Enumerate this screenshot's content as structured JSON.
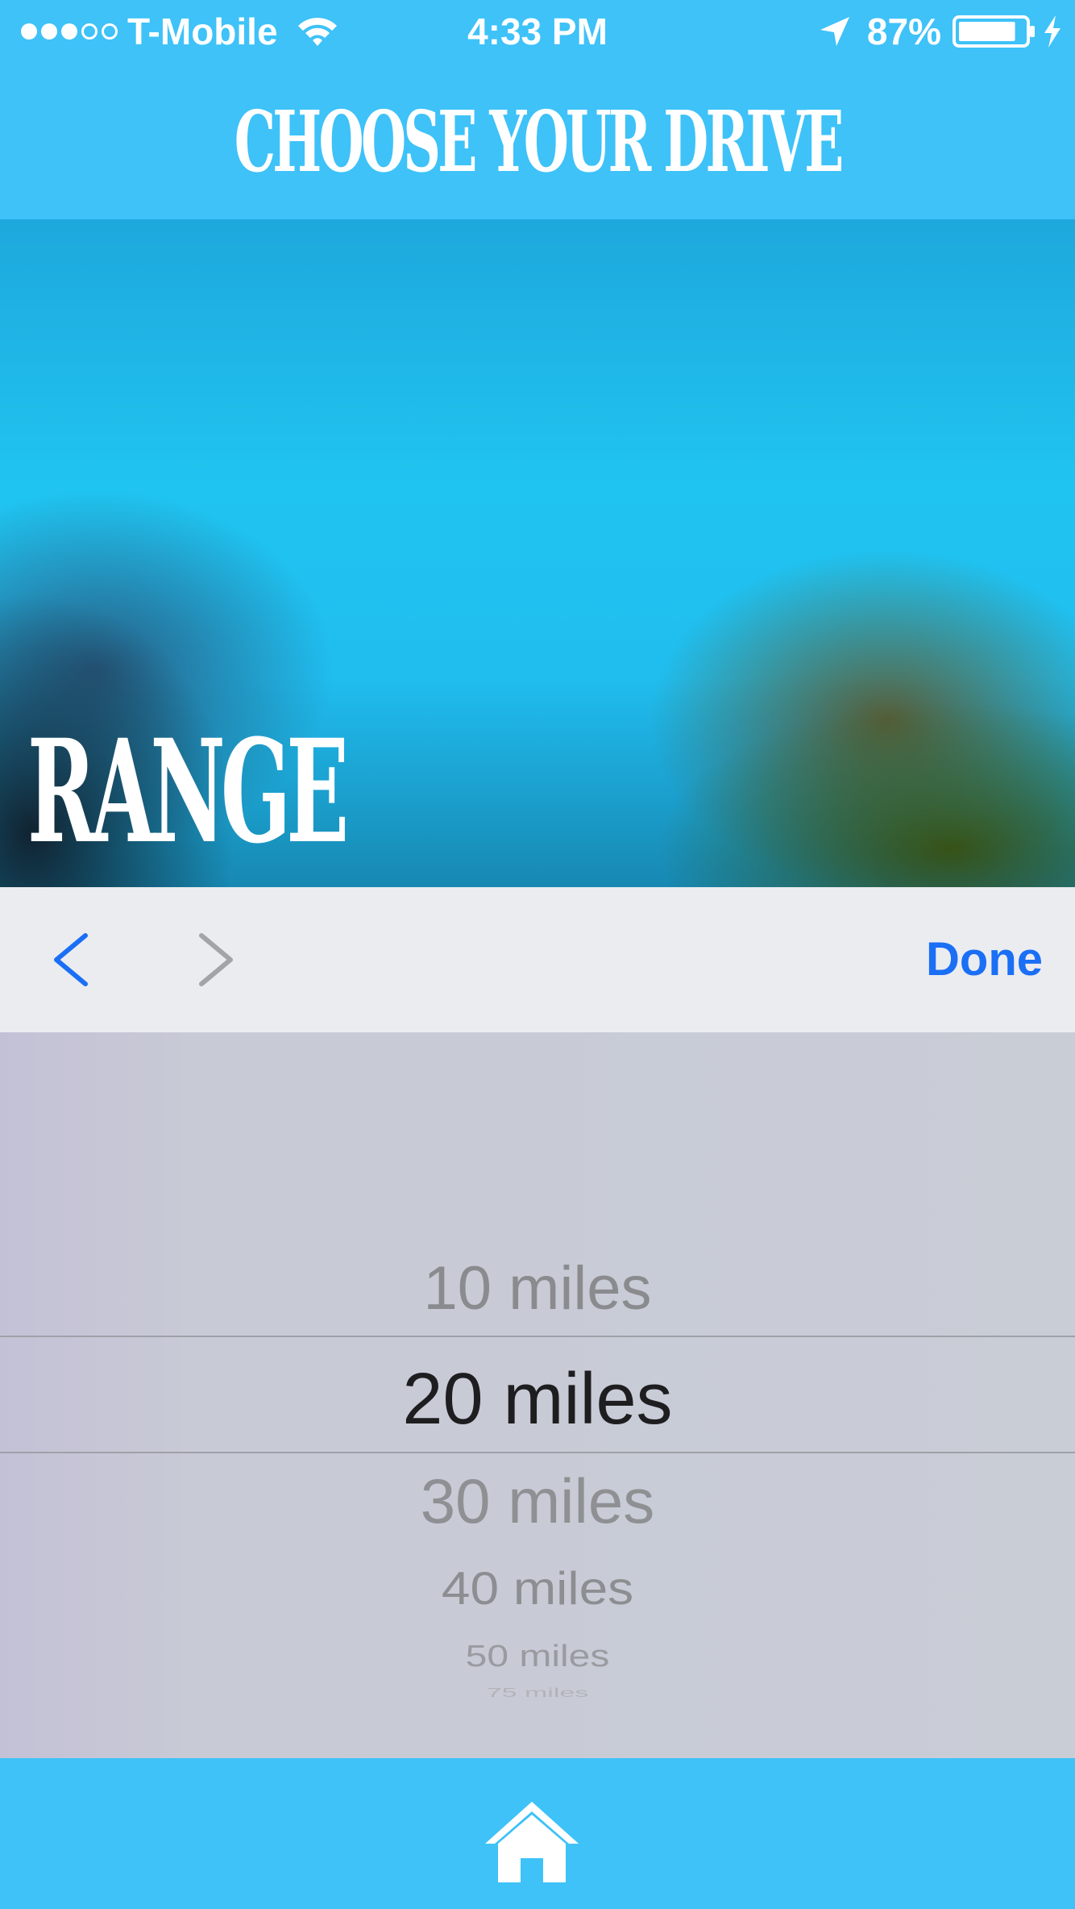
{
  "status_bar": {
    "carrier": "T-Mobile",
    "signal_bars_filled": 3,
    "signal_bars_total": 5,
    "time": "4:33 PM",
    "battery": "87%",
    "battery_level": 0.87
  },
  "nav": {
    "title": "CHOOSE YOUR DRIVE"
  },
  "hero": {
    "label": "RANGE"
  },
  "toolbar": {
    "done_label": "Done"
  },
  "picker": {
    "options": [
      "10 miles",
      "20 miles",
      "30 miles",
      "40 miles",
      "50 miles",
      "75 miles"
    ],
    "selected": "20 miles"
  },
  "colors": {
    "accent_blue": "#3ec2f8",
    "toolbar_tint": "#1a6ff5",
    "picker_bg": "#c9cdd6"
  },
  "icons": [
    "wifi-icon",
    "location-arrow-icon",
    "battery-icon",
    "charging-bolt-icon",
    "chevron-left-icon",
    "chevron-right-icon",
    "home-icon"
  ]
}
